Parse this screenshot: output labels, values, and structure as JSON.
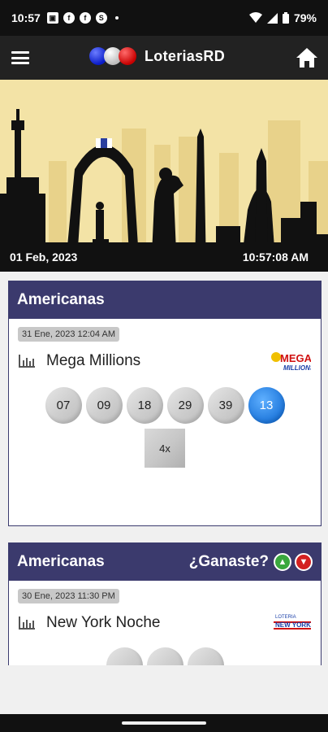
{
  "status_bar": {
    "time": "10:57",
    "battery": "79%",
    "notification_icons": [
      "news-icon",
      "facebook-icon",
      "facebook-icon",
      "skype-icon"
    ]
  },
  "app_bar": {
    "title": "LoteriasRD"
  },
  "banner": {
    "date": "01 Feb, 2023",
    "time": "10:57:08 AM"
  },
  "cards": [
    {
      "header": "Americanas",
      "date": "31 Ene, 2023 12:04 AM",
      "game": "Mega Millions",
      "logo_text_top": "MEGA",
      "logo_text_bottom": "MILLIONS",
      "numbers": [
        "07",
        "09",
        "18",
        "29",
        "39"
      ],
      "bonus": "13",
      "multiplier": "4x"
    },
    {
      "header": "Americanas",
      "question": "¿Ganaste?",
      "date": "30 Ene, 2023 11:30 PM",
      "game": "New York Noche",
      "logo_text_top": "LOTERIA",
      "logo_text_bottom": "NEW YORK"
    }
  ],
  "colors": {
    "card_header": "#3b3a6d",
    "banner_bg": "#f3e3a6",
    "bonus_ball": "#1a73d9"
  }
}
